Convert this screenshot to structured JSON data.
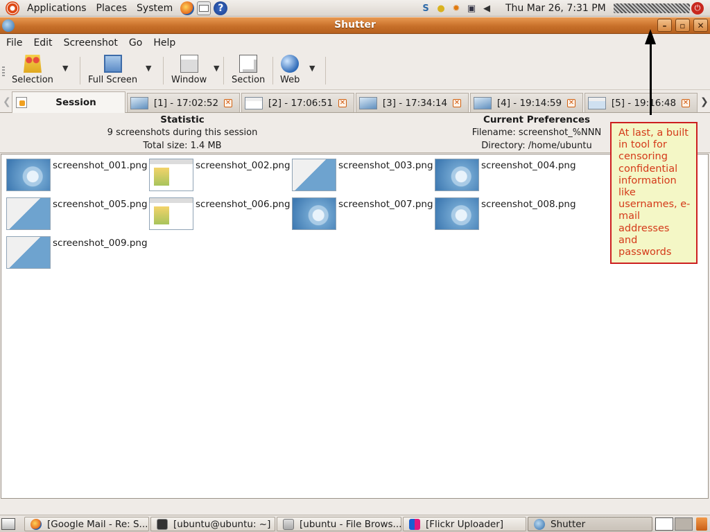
{
  "top_panel": {
    "menus": [
      "Applications",
      "Places",
      "System"
    ],
    "clock": "Thu Mar 26,  7:31 PM"
  },
  "window": {
    "title": "Shutter",
    "buttons": {
      "minimize": "–",
      "maximize": "▫",
      "close": "✕"
    }
  },
  "menubar": [
    "File",
    "Edit",
    "Screenshot",
    "Go",
    "Help"
  ],
  "toolbar": {
    "selection": "Selection",
    "full_screen": "Full Screen",
    "window": "Window",
    "section": "Section",
    "web": "Web"
  },
  "tabs": [
    {
      "label": "Session"
    },
    {
      "label": "[1] - 17:02:52"
    },
    {
      "label": "[2] - 17:06:51"
    },
    {
      "label": "[3] - 17:34:14"
    },
    {
      "label": "[4] - 19:14:59"
    },
    {
      "label": "[5] - 19:16:48"
    }
  ],
  "statistic": {
    "heading": "Statistic",
    "count": "9 screenshots during this session",
    "size": "Total size: 1.4 MB"
  },
  "preferences": {
    "heading": "Current Preferences",
    "filename": "Filename: screenshot_%NNN",
    "directory": "Directory: /home/ubuntu"
  },
  "screenshots": [
    {
      "name": "screenshot_001.png",
      "thumb": "desk"
    },
    {
      "name": "screenshot_002.png",
      "thumb": "doc"
    },
    {
      "name": "screenshot_003.png",
      "thumb": "mix"
    },
    {
      "name": "screenshot_004.png",
      "thumb": "desk"
    },
    {
      "name": "screenshot_005.png",
      "thumb": "mix"
    },
    {
      "name": "screenshot_006.png",
      "thumb": "doc"
    },
    {
      "name": "screenshot_007.png",
      "thumb": "desk"
    },
    {
      "name": "screenshot_008.png",
      "thumb": "desk"
    },
    {
      "name": "screenshot_009.png",
      "thumb": "mix"
    }
  ],
  "annotation": {
    "lines": [
      "At last, a built",
      "in tool for",
      "censoring",
      "confidential",
      "information",
      "like",
      "usernames, e-",
      "mail",
      "addresses",
      "and",
      "passwords"
    ]
  },
  "taskbar": [
    {
      "label": "[Google Mail - Re: S...",
      "icon": "firefox-icon"
    },
    {
      "label": "[ubuntu@ubuntu: ~]",
      "icon": "terminal-icon"
    },
    {
      "label": "[ubuntu - File Brows...",
      "icon": "file-manager-icon"
    },
    {
      "label": "[Flickr Uploader]",
      "icon": "flickr-icon"
    },
    {
      "label": "Shutter",
      "icon": "shutter-icon"
    }
  ],
  "colors": {
    "title_bar": "#c8702a",
    "annotation_border": "#cc1f1f",
    "annotation_text": "#d43a1a",
    "annotation_bg": "#f4f7c6"
  }
}
